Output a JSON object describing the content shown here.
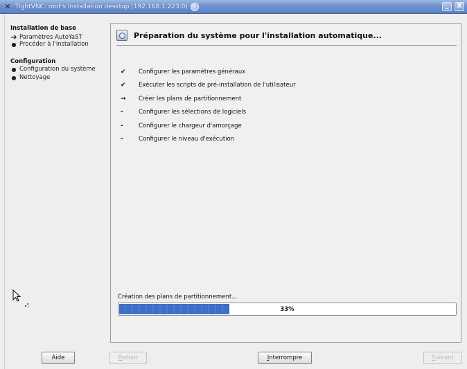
{
  "window": {
    "title": "TightVNC: root's Installation desktop (192.168.1.223:0)",
    "minimize_glyph": "_",
    "close_glyph": "X",
    "app_icon_glyph": "✕"
  },
  "sidebar": {
    "sections": [
      {
        "heading": "Installation de base",
        "items": [
          {
            "label": "Paramètres AutoYaST",
            "state": "current"
          },
          {
            "label": "Procéder à l'installation",
            "state": "pending"
          }
        ]
      },
      {
        "heading": "Configuration",
        "items": [
          {
            "label": "Configuration du système",
            "state": "pending"
          },
          {
            "label": "Nettoyage",
            "state": "pending"
          }
        ]
      }
    ],
    "current_marker": "➜",
    "pending_marker": "●"
  },
  "main": {
    "title": "Préparation du système pour l'installation automatique...",
    "steps": [
      {
        "symbol": "✔",
        "label": "Configurer les paramètres généraux"
      },
      {
        "symbol": "✔",
        "label": "Exécuter les scripts de pré-installation de l'utilisateur"
      },
      {
        "symbol": "→",
        "label": "Créer les plans de partitionnement"
      },
      {
        "symbol": "-",
        "label": "Configurer les sélections de logiciels"
      },
      {
        "symbol": "-",
        "label": "Configurer le chargeur d'amorçage"
      },
      {
        "symbol": "-",
        "label": "Configurer le niveau d'exécution"
      }
    ],
    "status_text": "Création des plans de partitionnement...",
    "progress": {
      "value": 33,
      "label": "33%"
    }
  },
  "buttons": {
    "help": {
      "label": "Aide",
      "enabled": true
    },
    "back": {
      "label": "Retour",
      "accel": "R",
      "rest": "etour",
      "enabled": false
    },
    "abort": {
      "label": "Interrompre",
      "accel": "I",
      "rest": "nterrompre",
      "enabled": true
    },
    "next": {
      "label": "Suivant",
      "accel": "S",
      "rest": "uivant",
      "enabled": false
    }
  },
  "colors": {
    "titlebar": "#6f93d0",
    "progress_fill": "#3f6fc4",
    "background": "#eeeeee"
  }
}
